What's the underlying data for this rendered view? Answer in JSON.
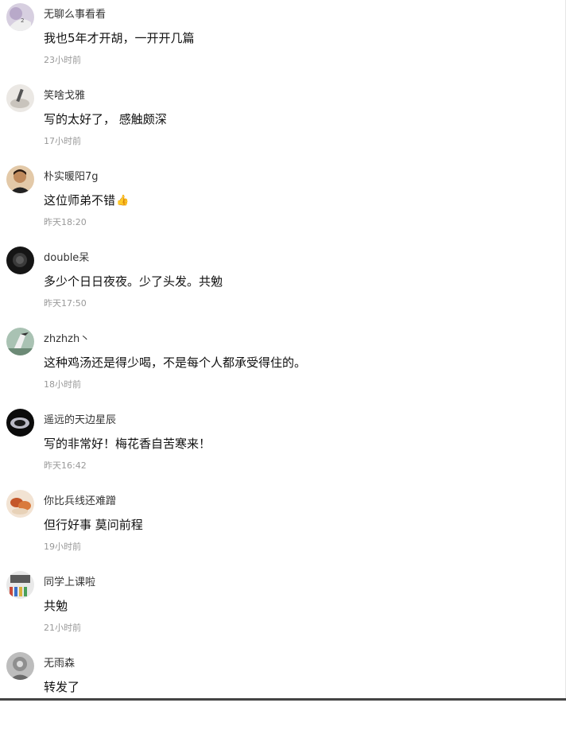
{
  "comments": [
    {
      "username": "无聊么事看看",
      "text": "我也5年才开胡，一开开几篇",
      "time": "23小时前",
      "avatar_color": "#c9b9d6"
    },
    {
      "username": "笑啥戈雅",
      "text": "写的太好了， 感触颇深",
      "time": "17小时前",
      "avatar_color": "#d8d4cf"
    },
    {
      "username": "朴实暖阳7g",
      "text": "这位师弟不错",
      "emoji": "👍",
      "time": "昨天18:20",
      "avatar_color": "#b07a4a"
    },
    {
      "username": "double呆",
      "text": "多少个日日夜夜。少了头发。共勉",
      "time": "昨天17:50",
      "avatar_color": "#1e1e1e"
    },
    {
      "username": "zhzhzh丶",
      "text": "这种鸡汤还是得少喝，不是每个人都承受得住的。",
      "time": "18小时前",
      "avatar_color": "#7f9b8c"
    },
    {
      "username": "遥远的天边星辰",
      "text": "写的非常好！梅花香自苦寒来！",
      "time": "昨天16:42",
      "avatar_color": "#111111"
    },
    {
      "username": "你比兵线还难蹭",
      "text": "但行好事 莫问前程",
      "time": "19小时前",
      "avatar_color": "#c96a3c"
    },
    {
      "username": "同学上课啦",
      "text": "共勉",
      "time": "21小时前",
      "avatar_color": "#8a8a8a"
    },
    {
      "username": "无雨森",
      "text": "转发了",
      "time": "",
      "avatar_color": "#9a9a9a"
    }
  ]
}
